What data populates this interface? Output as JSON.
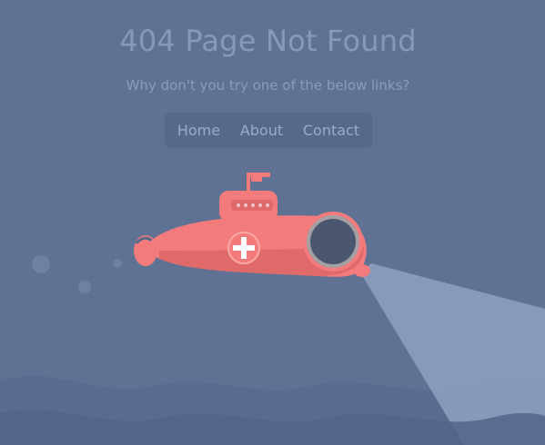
{
  "page": {
    "title": "404 Page Not Found",
    "subtitle": "Why don't you try one of the below links?"
  },
  "nav": {
    "items": [
      {
        "label": "Home"
      },
      {
        "label": "About"
      },
      {
        "label": "Contact"
      }
    ]
  },
  "colors": {
    "background": "#5f7294",
    "submarine": "#f47b7b",
    "light_beam": "#8c9dbb",
    "waves": "#52658a"
  }
}
